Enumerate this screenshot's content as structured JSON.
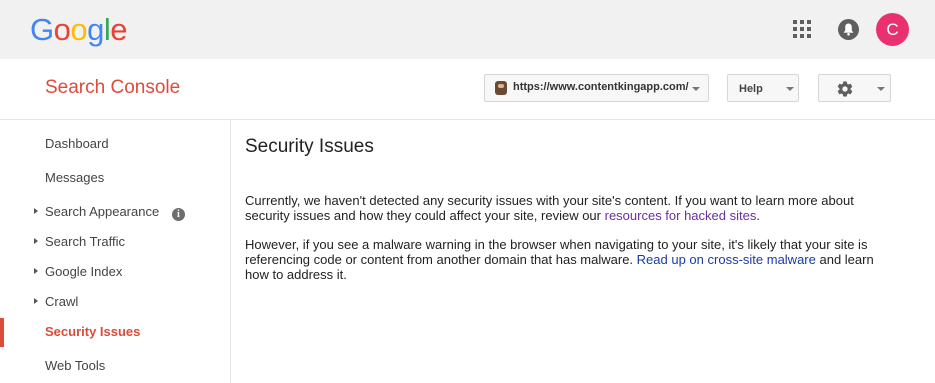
{
  "google_bar": {
    "logo_letters": [
      {
        "char": "G",
        "color": "#4285F4"
      },
      {
        "char": "o",
        "color": "#EA4335"
      },
      {
        "char": "o",
        "color": "#FBBC05"
      },
      {
        "char": "g",
        "color": "#4285F4"
      },
      {
        "char": "l",
        "color": "#34A853"
      },
      {
        "char": "e",
        "color": "#EA4335"
      }
    ],
    "apps_icon": "apps-grid-icon",
    "notifications_icon": "bell-icon",
    "avatar_letter": "C",
    "avatar_color": "#e8316e"
  },
  "header": {
    "product_title": "Search Console",
    "site_url": "https://www.contentkingapp.com/",
    "help_label": "Help",
    "settings_icon": "gear-icon"
  },
  "sidebar": {
    "items": [
      {
        "label": "Dashboard",
        "expandable": false
      },
      {
        "label": "Messages",
        "expandable": false
      },
      {
        "label": "Search Appearance",
        "expandable": true,
        "info_icon": "i"
      },
      {
        "label": "Search Traffic",
        "expandable": true
      },
      {
        "label": "Google Index",
        "expandable": true
      },
      {
        "label": "Crawl",
        "expandable": true
      },
      {
        "label": "Security Issues",
        "expandable": false,
        "active": true
      },
      {
        "label": "Web Tools",
        "expandable": false
      }
    ]
  },
  "main": {
    "title": "Security Issues",
    "para1_text": "Currently, we haven't detected any security issues with your site's content. If you want to learn more about security issues and how they could affect your site, review our ",
    "para1_link": "resources for hacked sites",
    "para1_end": ".",
    "para2_text": "However, if you see a malware warning in the browser when navigating to your site, it's likely that your site is referencing code or content from another domain that has malware. ",
    "para2_link": "Read up on cross-site malware",
    "para2_end": " and learn how to address it."
  },
  "colors": {
    "accent_red": "#dd4b39",
    "link_visited": "#6a2fa0",
    "link": "#1a3aa8"
  }
}
